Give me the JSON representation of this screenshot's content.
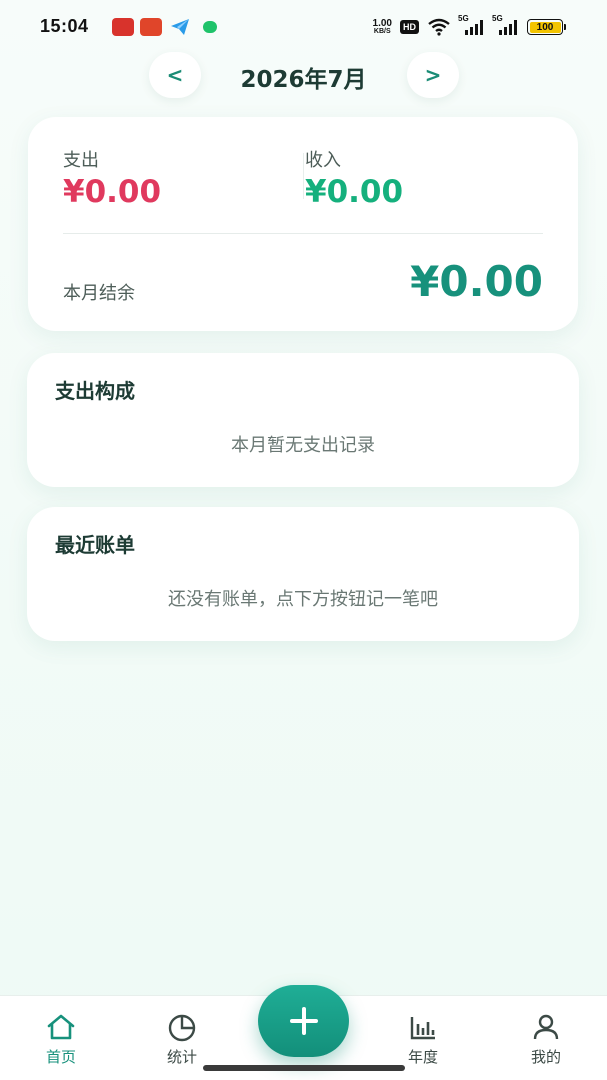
{
  "status_bar": {
    "time": "15:04",
    "net_speed_value": "1.00",
    "net_speed_unit": "KB/S",
    "hd_badge": "HD",
    "signal1_tag": "5G",
    "signal2_tag": "5G",
    "battery": "100"
  },
  "month_nav": {
    "prev_label": "<",
    "title": "2026年7月",
    "next_label": ">"
  },
  "summary": {
    "expense_label": "支出",
    "expense_value": "¥0.00",
    "income_label": "收入",
    "income_value": "¥0.00",
    "balance_label": "本月结余",
    "balance_value": "¥0.00"
  },
  "composition": {
    "title": "支出构成",
    "empty_text": "本月暂无支出记录"
  },
  "recent_bills": {
    "title": "最近账单",
    "empty_text": "还没有账单，点下方按钮记一笔吧"
  },
  "bottom_nav": {
    "tabs": [
      {
        "label": "首页",
        "icon": "home-icon",
        "active": true
      },
      {
        "label": "统计",
        "icon": "pie-chart-icon",
        "active": false
      },
      {
        "label": "年度",
        "icon": "bar-chart-icon",
        "active": false
      },
      {
        "label": "我的",
        "icon": "user-icon",
        "active": false
      }
    ],
    "add_button_icon": "plus-icon"
  },
  "colors": {
    "accent": "#17917c",
    "expense": "#e0395e",
    "income": "#15b07d"
  }
}
